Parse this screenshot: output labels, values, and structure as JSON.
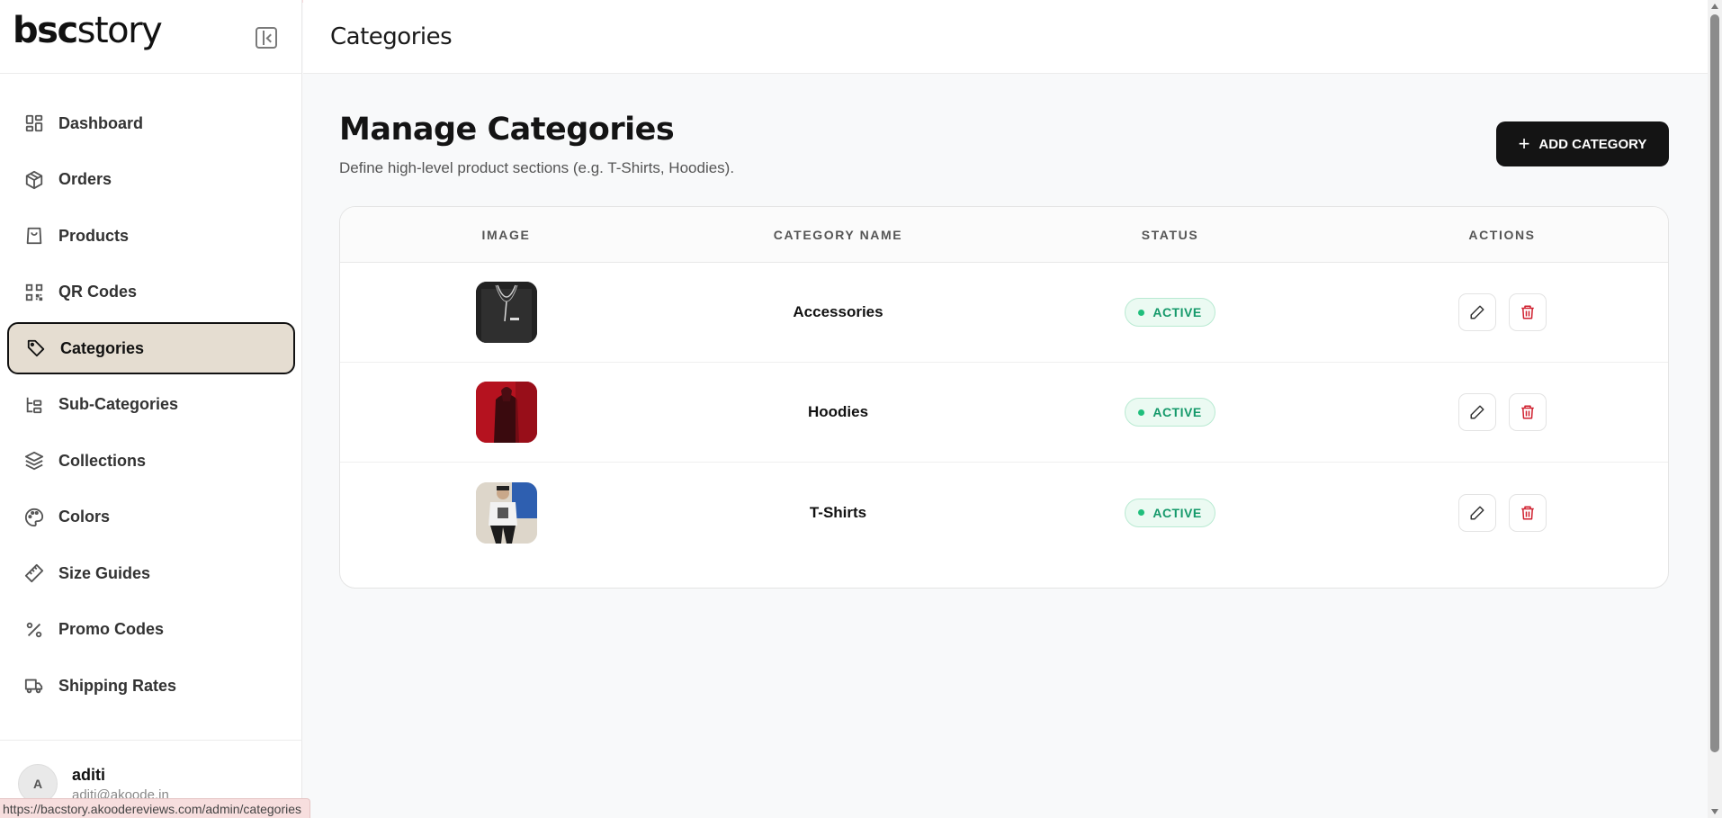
{
  "brand": {
    "part1": "bsc",
    "part2": "story"
  },
  "sidebar": {
    "items": [
      {
        "label": "Dashboard",
        "icon": "dashboard-icon"
      },
      {
        "label": "Orders",
        "icon": "box-icon"
      },
      {
        "label": "Products",
        "icon": "shopping-bag-icon"
      },
      {
        "label": "QR Codes",
        "icon": "qr-code-icon"
      },
      {
        "label": "Categories",
        "icon": "tag-icon",
        "active": true
      },
      {
        "label": "Sub-Categories",
        "icon": "hierarchy-icon"
      },
      {
        "label": "Collections",
        "icon": "layers-icon"
      },
      {
        "label": "Colors",
        "icon": "palette-icon"
      },
      {
        "label": "Size Guides",
        "icon": "ruler-icon"
      },
      {
        "label": "Promo Codes",
        "icon": "percent-icon"
      },
      {
        "label": "Shipping Rates",
        "icon": "truck-icon"
      }
    ],
    "user": {
      "initial": "A",
      "name": "aditi",
      "email": "aditi@akoode.in"
    }
  },
  "status_bar_url": "https://bacstory.akoodereviews.com/admin/categories",
  "header": {
    "title": "Categories"
  },
  "page": {
    "title": "Manage Categories",
    "subtitle": "Define high-level product sections (e.g. T-Shirts, Hoodies).",
    "add_button_label": "ADD CATEGORY"
  },
  "table": {
    "columns": [
      "IMAGE",
      "CATEGORY NAME",
      "STATUS",
      "ACTIONS"
    ],
    "rows": [
      {
        "name": "Accessories",
        "status": "ACTIVE",
        "image": "necklace-photo"
      },
      {
        "name": "Hoodies",
        "status": "ACTIVE",
        "image": "red-hoodie-photo"
      },
      {
        "name": "T-Shirts",
        "status": "ACTIVE",
        "image": "tshirt-photo"
      }
    ]
  },
  "colors": {
    "accent_dark": "#141414",
    "active_nav_bg": "#e5ddd1",
    "status_green": "#14996a",
    "delete_red": "#d0202f"
  }
}
